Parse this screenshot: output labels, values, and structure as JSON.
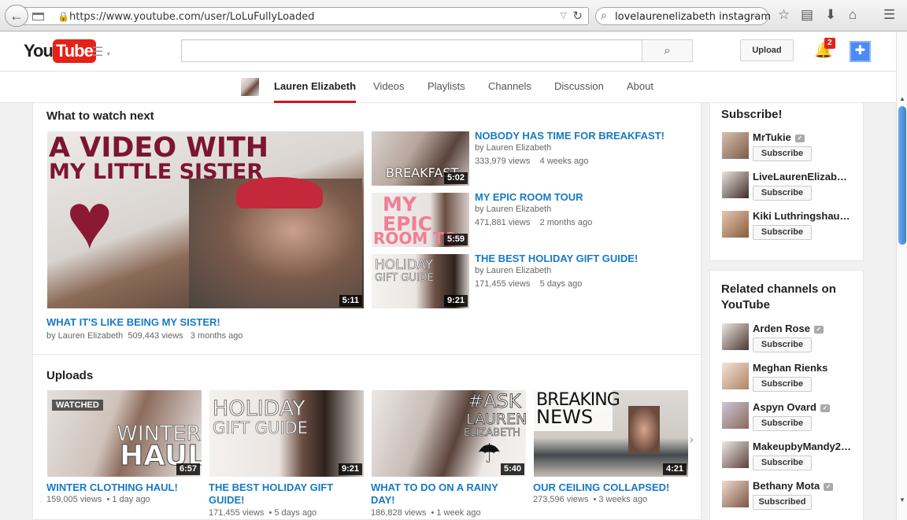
{
  "browser": {
    "url": "https://www.youtube.com/user/LoLuFullyLoaded",
    "search": "lovelaurenelizabeth instagram"
  },
  "header": {
    "logo_you": "You",
    "logo_tube": "Tube",
    "upload_label": "Upload",
    "notification_count": "2"
  },
  "tabs": [
    {
      "label": "Lauren Elizabeth",
      "active": true
    },
    {
      "label": "Videos"
    },
    {
      "label": "Playlists"
    },
    {
      "label": "Channels"
    },
    {
      "label": "Discussion"
    },
    {
      "label": "About"
    }
  ],
  "watch_next": {
    "title": "What to watch next",
    "featured": {
      "thumb_line1": "A VIDEO WITH",
      "thumb_line2": "MY LITTLE SISTER",
      "duration": "5:11",
      "title": "WHAT IT'S LIKE BEING MY SISTER!",
      "author": "by Lauren Elizabeth",
      "views": "509,443 views",
      "age": "3 months ago"
    },
    "list": [
      {
        "thumb_text": "BREAKFAST",
        "duration": "5:02",
        "title": "NOBODY HAS TIME FOR BREAKFAST!",
        "author": "by Lauren Elizabeth",
        "views": "333,979 views",
        "age": "4 weeks ago"
      },
      {
        "thumb_text": "MY EPIC",
        "thumb_text2": "ROOM TO",
        "duration": "5:59",
        "title": "MY EPIC ROOM TOUR",
        "author": "by Lauren Elizabeth",
        "views": "471,881 views",
        "age": "2 months ago"
      },
      {
        "thumb_text": "HOLIDAY",
        "thumb_text2": "GIFT GUIDE",
        "duration": "9:21",
        "title": "THE BEST HOLIDAY GIFT GUIDE!",
        "author": "by Lauren Elizabeth",
        "views": "171,455 views",
        "age": "5 days ago"
      }
    ]
  },
  "uploads": {
    "title": "Uploads",
    "items": [
      {
        "watched": "WATCHED",
        "thumb_text": "WINTER",
        "thumb_text2": "HAUL",
        "duration": "6:57",
        "title": "WINTER CLOTHING HAUL!",
        "views": "159,005 views",
        "age": "1 day ago"
      },
      {
        "thumb_text": "HOLIDAY",
        "thumb_text2": "GIFT GUIDE",
        "duration": "9:21",
        "title": "THE BEST HOLIDAY GIFT GUIDE!",
        "views": "171,455 views",
        "age": "5 days ago"
      },
      {
        "thumb_text": "#ASK",
        "thumb_text2": "LAUREN",
        "thumb_text3": "ELIZABETH",
        "duration": "5:40",
        "title": "WHAT TO DO ON A RAINY DAY!",
        "views": "186,828 views",
        "age": "1 week ago"
      },
      {
        "thumb_text": "BREAKING",
        "thumb_text2": "NEWS",
        "duration": "4:21",
        "title": "OUR CEILING COLLAPSED!",
        "views": "273,596 views",
        "age": "3 weeks ago"
      }
    ]
  },
  "subscribe": {
    "title": "Subscribe!",
    "channels": [
      {
        "name": "MrTukie",
        "button": "Subscribe",
        "verified": true
      },
      {
        "name": "LiveLaurenElizab…",
        "button": "Subscribe",
        "verified": false
      },
      {
        "name": "Kiki Luthringshau…",
        "button": "Subscribe",
        "verified": false
      }
    ]
  },
  "related": {
    "title": "Related channels on YouTube",
    "channels": [
      {
        "name": "Arden Rose",
        "button": "Subscribe",
        "verified": true
      },
      {
        "name": "Meghan Rienks",
        "button": "Subscribe",
        "verified": false
      },
      {
        "name": "Aspyn Ovard",
        "button": "Subscribe",
        "verified": true
      },
      {
        "name": "MakeupbyMandy2…",
        "button": "Subscribe",
        "verified": false
      },
      {
        "name": "Bethany Mota",
        "button": "Subscribed",
        "verified": true
      }
    ]
  },
  "colors": {
    "link": "#167ac6",
    "brand_red": "#e62117",
    "tab_underline": "#cc181e"
  }
}
